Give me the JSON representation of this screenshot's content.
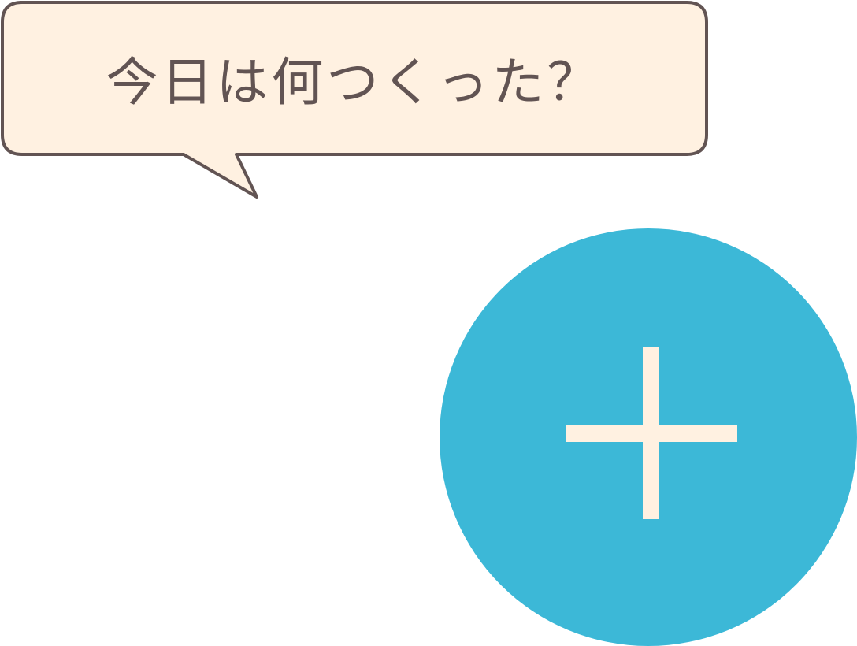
{
  "speech_bubble": {
    "text": "今日は何つくった？"
  },
  "add_button": {
    "icon": "plus-icon"
  },
  "colors": {
    "bubble_fill": "#fff1e1",
    "bubble_border": "#625453",
    "bubble_text": "#625453",
    "button_fill": "#3cb8d7",
    "plus_color": "#fff1e1"
  }
}
